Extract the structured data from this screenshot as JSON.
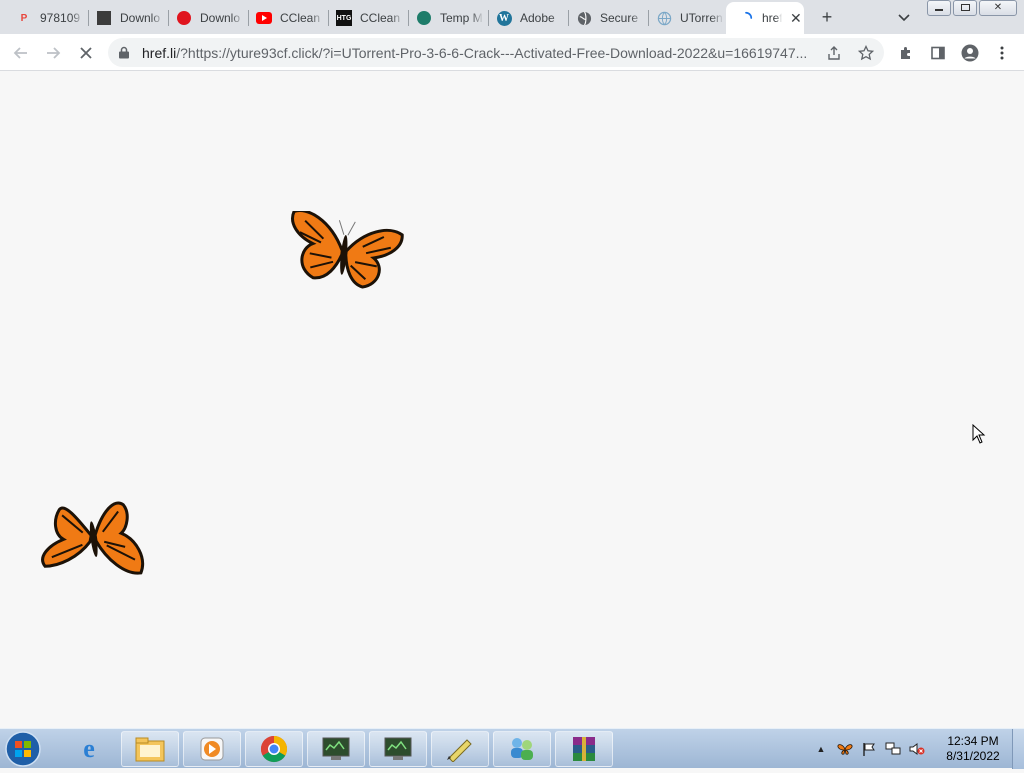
{
  "browser": {
    "tabs": [
      {
        "title": "978109",
        "icon": "p-logo-icon",
        "color": "#e8453c"
      },
      {
        "title": "Downlo",
        "icon": "dark-square-icon",
        "color": "#3c3c3c"
      },
      {
        "title": "Downlo",
        "icon": "red-circle-icon",
        "color": "#e0141e"
      },
      {
        "title": "CClean",
        "icon": "youtube-icon",
        "color": "#ff0000"
      },
      {
        "title": "CClean",
        "icon": "htg-icon",
        "color": "#111111"
      },
      {
        "title": "Temp M",
        "icon": "teal-circle-icon",
        "color": "#1e7c6a"
      },
      {
        "title": "Adobe",
        "icon": "wordpress-icon",
        "color": "#21759b"
      },
      {
        "title": "Secure",
        "icon": "globe-icon",
        "color": "#5f6368"
      },
      {
        "title": "UTorren",
        "icon": "globe-outline-icon",
        "color": "#7aa7c7"
      }
    ],
    "active_tab": {
      "title": "href",
      "icon": "loading-spinner-icon",
      "close": "✕"
    },
    "new_tab": "+",
    "url_host": "href.li",
    "url_rest": "/?https://yture93cf.click/?i=UTorrent-Pro-3-6-6-Crack---Activated-Free-Download-2022&u=16619747..."
  },
  "taskbar": {
    "clock_time": "12:34 PM",
    "clock_date": "8/31/2022",
    "pinned": [
      "internet-explorer-icon",
      "file-explorer-icon",
      "media-player-icon",
      "chrome-icon",
      "monitor-app-icon",
      "monitor-app-icon-2",
      "pen-tool-icon",
      "network-users-icon",
      "winrar-icon"
    ]
  },
  "colors": {
    "accent": "#1a73e8",
    "butterfly_orange": "#f07a14",
    "butterfly_dark": "#1c1208"
  }
}
